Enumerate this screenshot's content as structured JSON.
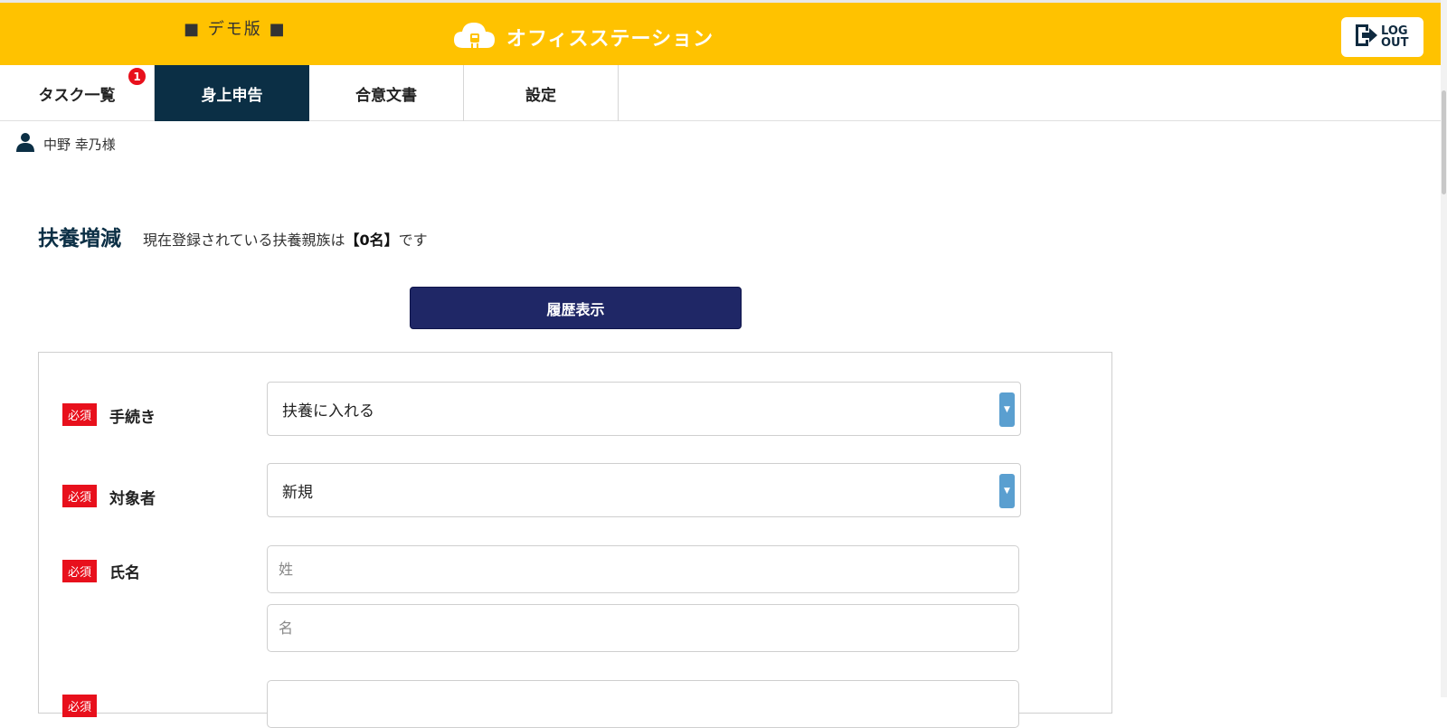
{
  "header": {
    "demo_label": "■ デモ版 ■",
    "brand_name": "オフィスステーション",
    "logout_line1": "LOG",
    "logout_line2": "OUT",
    "brand_color": "#ffc200"
  },
  "tabs": [
    {
      "label": "タスク一覧",
      "badge": "1",
      "active": false
    },
    {
      "label": "身上申告",
      "active": true
    },
    {
      "label": "合意文書",
      "active": false
    },
    {
      "label": "設定",
      "active": false
    }
  ],
  "user": {
    "name": "中野 幸乃様",
    "icon": "user-icon"
  },
  "section": {
    "title": "扶養増減",
    "desc_prefix": "現在登録されている扶養親族は",
    "desc_count": "【0名】",
    "desc_suffix": "です"
  },
  "history_button": "履歴表示",
  "form": {
    "required_label": "必須",
    "procedure": {
      "label": "手続き",
      "value": "扶養に入れる"
    },
    "target": {
      "label": "対象者",
      "value": "新規"
    },
    "name": {
      "label": "氏名",
      "last_placeholder": "姓",
      "first_placeholder": "名"
    }
  }
}
